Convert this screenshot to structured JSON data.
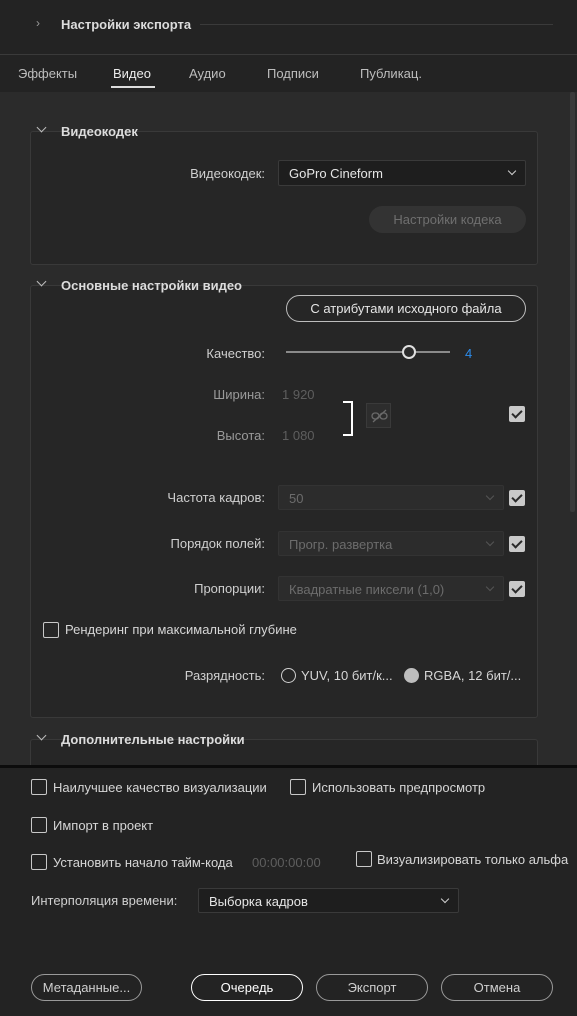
{
  "export_settings": {
    "title": "Настройки экспорта"
  },
  "tabs": [
    {
      "label": "Эффекты"
    },
    {
      "label": "Видео"
    },
    {
      "label": "Аудио"
    },
    {
      "label": "Подписи"
    },
    {
      "label": "Публикац."
    }
  ],
  "codec_section": {
    "title": "Видеокодек",
    "codec_label": "Видеокодек:",
    "codec_value": "GoPro Cineform",
    "codec_settings_button": "Настройки кодека"
  },
  "basic_section": {
    "title": "Основные настройки видео",
    "match_source_button": "С атрибутами исходного файла",
    "quality_label": "Качество:",
    "quality_value": "4",
    "quality_fraction": 0.75,
    "width_label": "Ширина:",
    "width_value": "1 920",
    "height_label": "Высота:",
    "height_value": "1 080",
    "framerate_label": "Частота кадров:",
    "framerate_value": "50",
    "field_order_label": "Порядок полей:",
    "field_order_value": "Прогр. развертка",
    "aspect_label": "Пропорции:",
    "aspect_value": "Квадратные пиксели (1,0)",
    "max_depth_label": "Рендеринг при максимальной глубине",
    "depth_label": "Разрядность:",
    "depth_option1": "YUV, 10 бит/к...",
    "depth_option2": "RGBA, 12 бит/..."
  },
  "advanced_section": {
    "title": "Дополнительные настройки"
  },
  "bottom": {
    "max_render_quality": "Наилучшее качество визуализации",
    "use_previews": "Использовать предпросмотр",
    "import_into_project": "Импорт в проект",
    "set_start_timecode": "Установить начало тайм-кода",
    "timecode_value": "00:00:00:00",
    "render_alpha_only": "Визуализировать только альфа",
    "time_interpolation_label": "Интерполяция времени:",
    "time_interpolation_value": "Выборка кадров"
  },
  "buttons": {
    "metadata": "Метаданные...",
    "queue": "Очередь",
    "export": "Экспорт",
    "cancel": "Отмена"
  },
  "colors": {
    "accent": "#2d8ceb",
    "background": "#232323",
    "panel": "#2b2b2b"
  }
}
